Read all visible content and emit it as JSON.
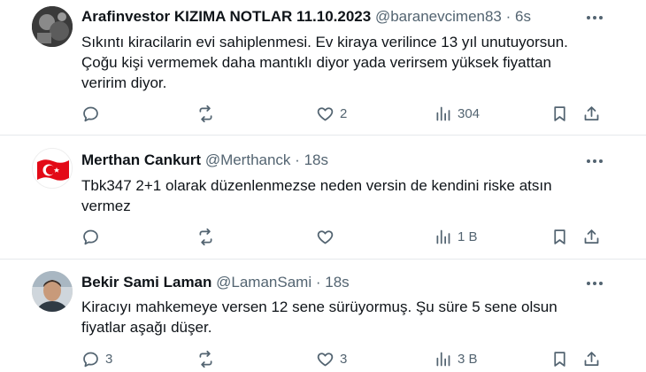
{
  "tweets": [
    {
      "name": "Arafinvestor KIZIMA NOTLAR 11.10.2023",
      "handle": "@baranevcimen83",
      "sep": "·",
      "time": "6s",
      "text": "Sıkıntı kiracilarin evi sahiplenmesi. Ev kiraya verilince 13 yıl unutuyorsun. Çoğu kişi vermemek daha mantıklı diyor yada verirsem yüksek fiyattan veririm diyor.",
      "replies": "",
      "retweets": "",
      "likes": "2",
      "views": "304"
    },
    {
      "name": "Merthan Cankurt",
      "handle": "@Merthanck",
      "sep": "·",
      "time": "18s",
      "text": "Tbk347 2+1 olarak düzenlenmezse neden versin de kendini riske atsın vermez",
      "replies": "",
      "retweets": "",
      "likes": "",
      "views": "1 B"
    },
    {
      "name": "Bekir Sami Laman",
      "handle": "@LamanSami",
      "sep": "·",
      "time": "18s",
      "text": "Kiracıyı mahkemeye versen 12 sene sürüyormuş. Şu süre 5 sene olsun fiyatlar aşağı düşer.",
      "replies": "3",
      "retweets": "",
      "likes": "3",
      "views": "3 B"
    }
  ],
  "colors": {
    "text": "#0f1419",
    "secondary": "#536471",
    "divider": "#e6e9ec",
    "flag_red": "#e30a17"
  }
}
